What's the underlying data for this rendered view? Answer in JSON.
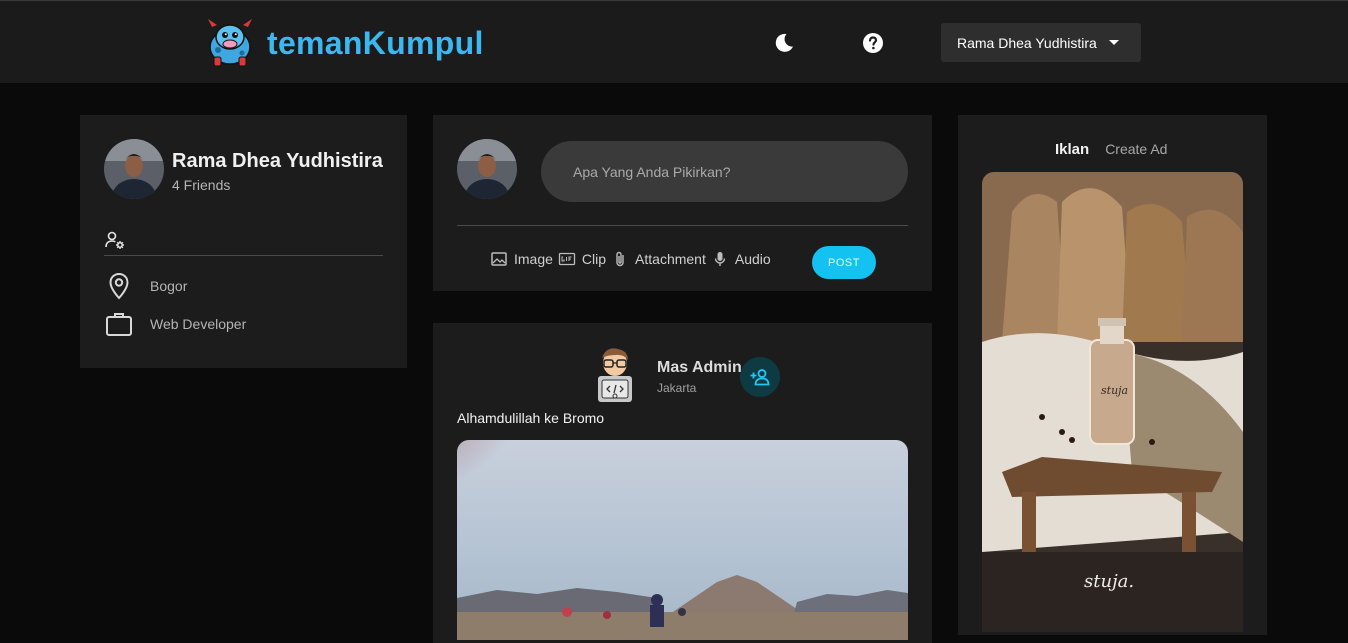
{
  "header": {
    "brand": "temanKumpul",
    "user_menu_label": "Rama Dhea Yudhistira",
    "icons": [
      "moon-icon",
      "help-icon",
      "caret-down-icon"
    ]
  },
  "profile": {
    "name": "Rama Dhea Yudhistira",
    "friends": "4 Friends",
    "location": "Bogor",
    "occupation": "Web Developer",
    "icons": [
      "user-settings-icon",
      "location-pin-icon",
      "briefcase-icon"
    ]
  },
  "composer": {
    "placeholder": "Apa Yang Anda Pikirkan?",
    "attachments": [
      {
        "label": "Image",
        "icon": "image-icon"
      },
      {
        "label": "Clip",
        "icon": "gif-icon"
      },
      {
        "label": "Attachment",
        "icon": "paperclip-icon"
      },
      {
        "label": "Audio",
        "icon": "microphone-icon"
      }
    ],
    "post_label": "POST"
  },
  "feed": {
    "post": {
      "author": "Mas Admin",
      "location": "Jakarta",
      "text": "Alhamdulillah ke Bromo",
      "add_friend_icon": "add-friend-icon"
    }
  },
  "ads": {
    "tabs": [
      "Iklan",
      "Create Ad"
    ],
    "ad_brand_mark": "stuja."
  },
  "colors": {
    "accent": "#13c2f0",
    "brand": "#3cb8f0",
    "navbar": "#1b1b1b",
    "background": "#0a0a0a",
    "card": "#1c1c1c"
  }
}
